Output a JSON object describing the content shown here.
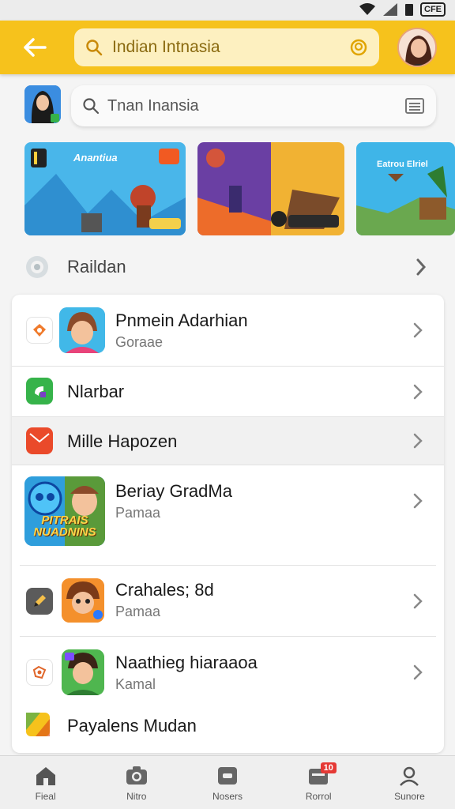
{
  "status_bar": {
    "battery_label": "CFE"
  },
  "header": {
    "search_query": "Indian Intnasia"
  },
  "search_bar": {
    "query": "Tnan Inansia"
  },
  "banners": [
    {
      "title": "Anantiua"
    },
    {
      "title": ""
    },
    {
      "title": "Eatrou Elriel"
    }
  ],
  "section": {
    "title": "Raildan"
  },
  "list": [
    {
      "title": "Pnmein Adarhian",
      "subtitle": "Goraae"
    },
    {
      "title": "Nlarbar",
      "subtitle": ""
    },
    {
      "title": "Mille Hapozen",
      "subtitle": ""
    },
    {
      "title": "Beriay GradMa",
      "subtitle": "Pamaa",
      "art_text": "PITRAIS NUADNINS"
    },
    {
      "title": "Crahales; 8d",
      "subtitle": "Pamaa"
    },
    {
      "title": "Naathieg hiaraaoa",
      "subtitle": "Kamal"
    },
    {
      "title": "Payalens Mudan",
      "subtitle": ""
    }
  ],
  "bottom_nav": [
    {
      "label": "Fieal",
      "icon": "home-icon"
    },
    {
      "label": "Nitro",
      "icon": "camera-icon"
    },
    {
      "label": "Nosers",
      "icon": "gallery-icon"
    },
    {
      "label": "Rorrol",
      "icon": "notifications-icon",
      "badge": "10"
    },
    {
      "label": "Sunore",
      "icon": "profile-icon"
    }
  ],
  "colors": {
    "accent": "#f6c21c",
    "accent_light": "#fdf0c0",
    "background": "#f4f4f4"
  }
}
